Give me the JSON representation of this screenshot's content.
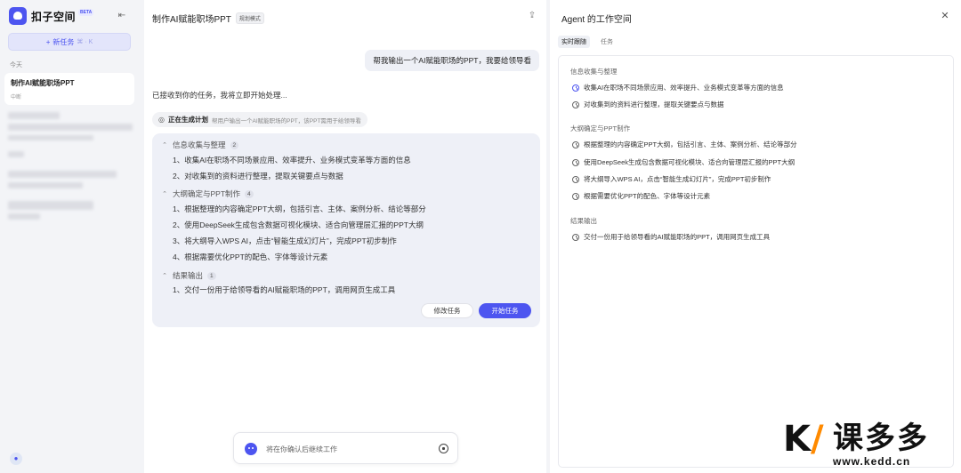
{
  "sidebar": {
    "brand_name": "扣子空间",
    "brand_badge": "BETA",
    "collapse_icon": "sidebar-collapse-icon",
    "new_task_label": "新任务",
    "new_task_shortcut": "⌘ · K",
    "group_today": "今天",
    "conversations": [
      {
        "title": "制作AI赋能职场PPT",
        "subtitle": "中断"
      }
    ]
  },
  "chat": {
    "title": "制作AI赋能职场PPT",
    "mode_badge": "规划模式",
    "user_message": "帮我输出一个AI赋能职场的PPT，我要给领导看",
    "assistant_reply": "已接收到你的任务，我将立即开始处理...",
    "plan_status_label": "正在生成计划",
    "plan_status_desc": "帮用户输出一个AI赋能职场的PPT，该PPT需用于给领导看",
    "plan": {
      "sections": [
        {
          "title": "信息收集与整理",
          "count": "2",
          "steps": [
            "1、收集AI在职场不同场景应用、效率提升、业务模式变革等方面的信息",
            "2、对收集到的资料进行整理，提取关键要点与数据"
          ]
        },
        {
          "title": "大纲确定与PPT制作",
          "count": "4",
          "steps": [
            "1、根据整理的内容确定PPT大纲，包括引言、主体、案例分析、结论等部分",
            "2、使用DeepSeek生成包含数据可视化模块、适合向管理层汇报的PPT大纲",
            "3、将大纲导入WPS AI，点击“智能生成幻灯片”，完成PPT初步制作",
            "4、根据需要优化PPT的配色、字体等设计元素"
          ]
        },
        {
          "title": "结果输出",
          "count": "1",
          "steps": [
            "1、交付一份用于给领导看的AI赋能职场的PPT，调用网页生成工具"
          ]
        }
      ],
      "modify_label": "修改任务",
      "start_label": "开始任务"
    },
    "input_placeholder": "将在你确认后继续工作"
  },
  "workspace": {
    "title": "Agent 的工作空间",
    "tabs": [
      "实时跟随",
      "任务"
    ],
    "sections": [
      {
        "title": "信息收集与整理",
        "items": [
          "收集AI在职场不同场景应用、效率提升、业务模式变革等方面的信息",
          "对收集到的资料进行整理，提取关键要点与数据"
        ]
      },
      {
        "title": "大纲确定与PPT制作",
        "items": [
          "根据整理的内容确定PPT大纲，包括引言、主体、案例分析、结论等部分",
          "使用DeepSeek生成包含数据可视化模块、适合向管理层汇报的PPT大纲",
          "将大纲导入WPS AI，点击“智能生成幻灯片”，完成PPT初步制作",
          "根据需要优化PPT的配色、字体等设计元素"
        ]
      },
      {
        "title": "结果输出",
        "items": [
          "交付一份用于给领导看的AI赋能职场的PPT，调用网页生成工具"
        ]
      }
    ]
  },
  "watermark": {
    "brand": "课多多",
    "url": "www.kedd.cn"
  },
  "colors": {
    "accent": "#4d55f0",
    "sidebar_bg": "#f3f4f7",
    "plan_card_bg": "#eef0f7"
  }
}
